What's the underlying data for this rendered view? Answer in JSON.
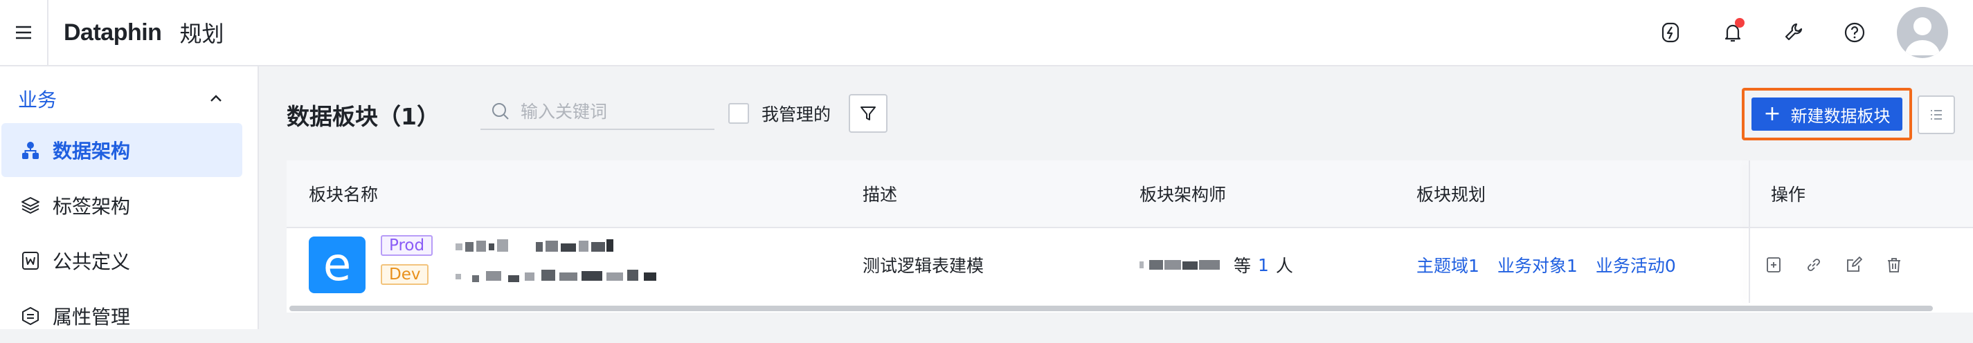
{
  "header": {
    "logo": "Dataphin",
    "app_name": "规划",
    "icons": [
      "menu-icon",
      "flash-icon",
      "bell-icon",
      "wrench-icon",
      "help-icon",
      "avatar"
    ],
    "accent_color": "#1f5fe0",
    "notification_color": "#f53f3f"
  },
  "sidebar": {
    "group_label": "业务",
    "items": [
      {
        "label": "数据架构",
        "icon": "architecture-icon",
        "active": true
      },
      {
        "label": "标签架构",
        "icon": "layers-icon",
        "active": false
      },
      {
        "label": "公共定义",
        "icon": "word-icon",
        "active": false
      },
      {
        "label": "属性管理",
        "icon": "property-icon",
        "active": false
      }
    ]
  },
  "main": {
    "title": "数据板块（1）",
    "search_placeholder": "输入关键词",
    "mine_label": "我管理的",
    "create_button": "新建数据板块",
    "highlight_color": "#f26a1b"
  },
  "table": {
    "columns": [
      "板块名称",
      "描述",
      "板块架构师",
      "板块规划",
      "操作"
    ],
    "rows": [
      {
        "logo_letter": "e",
        "tags": [
          "Prod",
          "Dev"
        ],
        "description": "测试逻辑表建模",
        "architect_suffix_pre": "等",
        "architect_count": "1",
        "architect_suffix_post": "人",
        "planning": [
          "主题域1",
          "业务对象1",
          "业务活动0"
        ],
        "operations": [
          "copy-icon",
          "link-icon",
          "edit-icon",
          "delete-icon"
        ]
      }
    ]
  }
}
